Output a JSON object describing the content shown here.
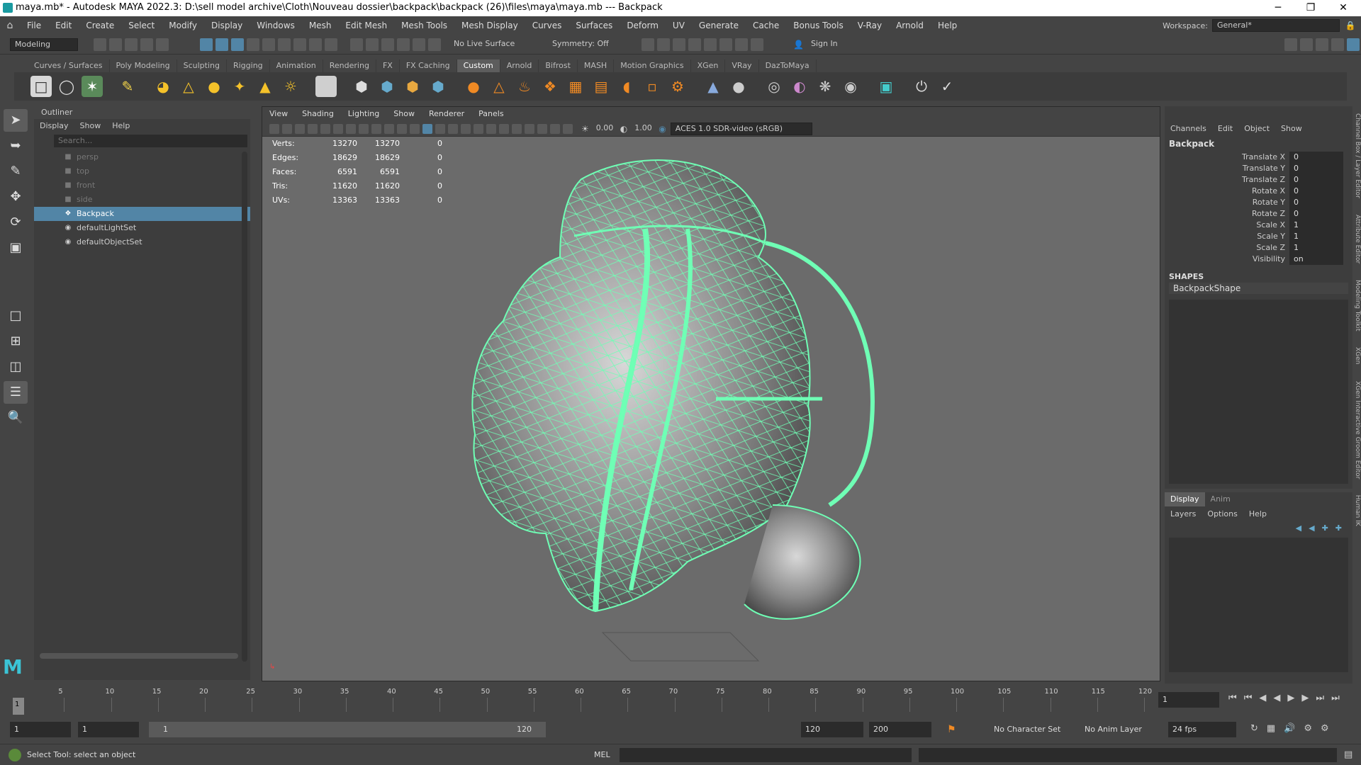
{
  "window": {
    "title": "maya.mb* - Autodesk MAYA 2022.3: D:\\sell model archive\\Cloth\\Nouveau dossier\\backpack\\backpack (26)\\files\\maya\\maya.mb  ---  Backpack",
    "minimize": "─",
    "maximize": "❐",
    "close": "✕"
  },
  "menubar": {
    "items": [
      "File",
      "Edit",
      "Create",
      "Select",
      "Modify",
      "Display",
      "Windows",
      "Mesh",
      "Edit Mesh",
      "Mesh Tools",
      "Mesh Display",
      "Curves",
      "Surfaces",
      "Deform",
      "UV",
      "Generate",
      "Cache",
      "Bonus Tools",
      "V-Ray",
      "Arnold",
      "Help"
    ],
    "workspace_label": "Workspace:",
    "workspace_value": "General*"
  },
  "statusline": {
    "mode": "Modeling",
    "live_surface": "No Live Surface",
    "symmetry": "Symmetry: Off",
    "sign_in": "Sign In"
  },
  "shelf": {
    "tabs": [
      "Curves / Surfaces",
      "Poly Modeling",
      "Sculpting",
      "Rigging",
      "Animation",
      "Rendering",
      "FX",
      "FX Caching",
      "Custom",
      "Arnold",
      "Bifrost",
      "MASH",
      "Motion Graphics",
      "XGen",
      "VRay",
      "DazToMaya"
    ],
    "active_tab": "Custom"
  },
  "outliner": {
    "title": "Outliner",
    "menu": [
      "Display",
      "Show",
      "Help"
    ],
    "search_placeholder": "Search...",
    "items": [
      {
        "label": "persp",
        "kind": "camera",
        "dim": true
      },
      {
        "label": "top",
        "kind": "camera",
        "dim": true
      },
      {
        "label": "front",
        "kind": "camera",
        "dim": true
      },
      {
        "label": "side",
        "kind": "camera",
        "dim": true
      },
      {
        "label": "Backpack",
        "kind": "mesh",
        "selected": true
      },
      {
        "label": "defaultLightSet",
        "kind": "set"
      },
      {
        "label": "defaultObjectSet",
        "kind": "set"
      }
    ]
  },
  "viewport": {
    "menu": [
      "View",
      "Shading",
      "Lighting",
      "Show",
      "Renderer",
      "Panels"
    ],
    "exposure": "0.00",
    "gamma": "1.00",
    "color_space": "ACES 1.0 SDR-video (sRGB)",
    "hud": [
      {
        "label": "Verts:",
        "a": "13270",
        "b": "13270",
        "c": "0"
      },
      {
        "label": "Edges:",
        "a": "18629",
        "b": "18629",
        "c": "0"
      },
      {
        "label": "Faces:",
        "a": "6591",
        "b": "6591",
        "c": "0"
      },
      {
        "label": "Tris:",
        "a": "11620",
        "b": "11620",
        "c": "0"
      },
      {
        "label": "UVs:",
        "a": "13363",
        "b": "13363",
        "c": "0"
      }
    ]
  },
  "channelbox": {
    "menu": [
      "Channels",
      "Edit",
      "Object",
      "Show"
    ],
    "object": "Backpack",
    "attrs": [
      {
        "name": "Translate X",
        "value": "0"
      },
      {
        "name": "Translate Y",
        "value": "0"
      },
      {
        "name": "Translate Z",
        "value": "0"
      },
      {
        "name": "Rotate X",
        "value": "0"
      },
      {
        "name": "Rotate Y",
        "value": "0"
      },
      {
        "name": "Rotate Z",
        "value": "0"
      },
      {
        "name": "Scale X",
        "value": "1"
      },
      {
        "name": "Scale Y",
        "value": "1"
      },
      {
        "name": "Scale Z",
        "value": "1"
      },
      {
        "name": "Visibility",
        "value": "on"
      }
    ],
    "shapes_label": "SHAPES",
    "shape_name": "BackpackShape",
    "side_tabs": [
      "Channel Box / Layer Editor",
      "Attribute Editor",
      "Modeling Toolkit",
      "XGen",
      "XGen Interactive Groom Editor",
      "Human IK"
    ]
  },
  "layers": {
    "tabs": [
      "Display",
      "Anim"
    ],
    "menu": [
      "Layers",
      "Options",
      "Help"
    ]
  },
  "timeline": {
    "ticks": [
      "5",
      "10",
      "15",
      "20",
      "25",
      "30",
      "35",
      "40",
      "45",
      "50",
      "55",
      "60",
      "65",
      "70",
      "75",
      "80",
      "85",
      "90",
      "95",
      "100",
      "105",
      "110",
      "115",
      "120"
    ],
    "current_frame": "1",
    "current_field": "1"
  },
  "range": {
    "start": "1",
    "start2": "1",
    "slider_start": "1",
    "slider_end": "120",
    "end": "120",
    "end2": "200",
    "character_set": "No Character Set",
    "anim_layer": "No Anim Layer",
    "fps": "24 fps"
  },
  "commandline": {
    "help": "Select Tool: select an object",
    "lang": "MEL"
  },
  "colors": {
    "selection_blue": "#5285a6",
    "wire_green": "#6fffb5",
    "maya_teal": "#1a9aa0"
  }
}
